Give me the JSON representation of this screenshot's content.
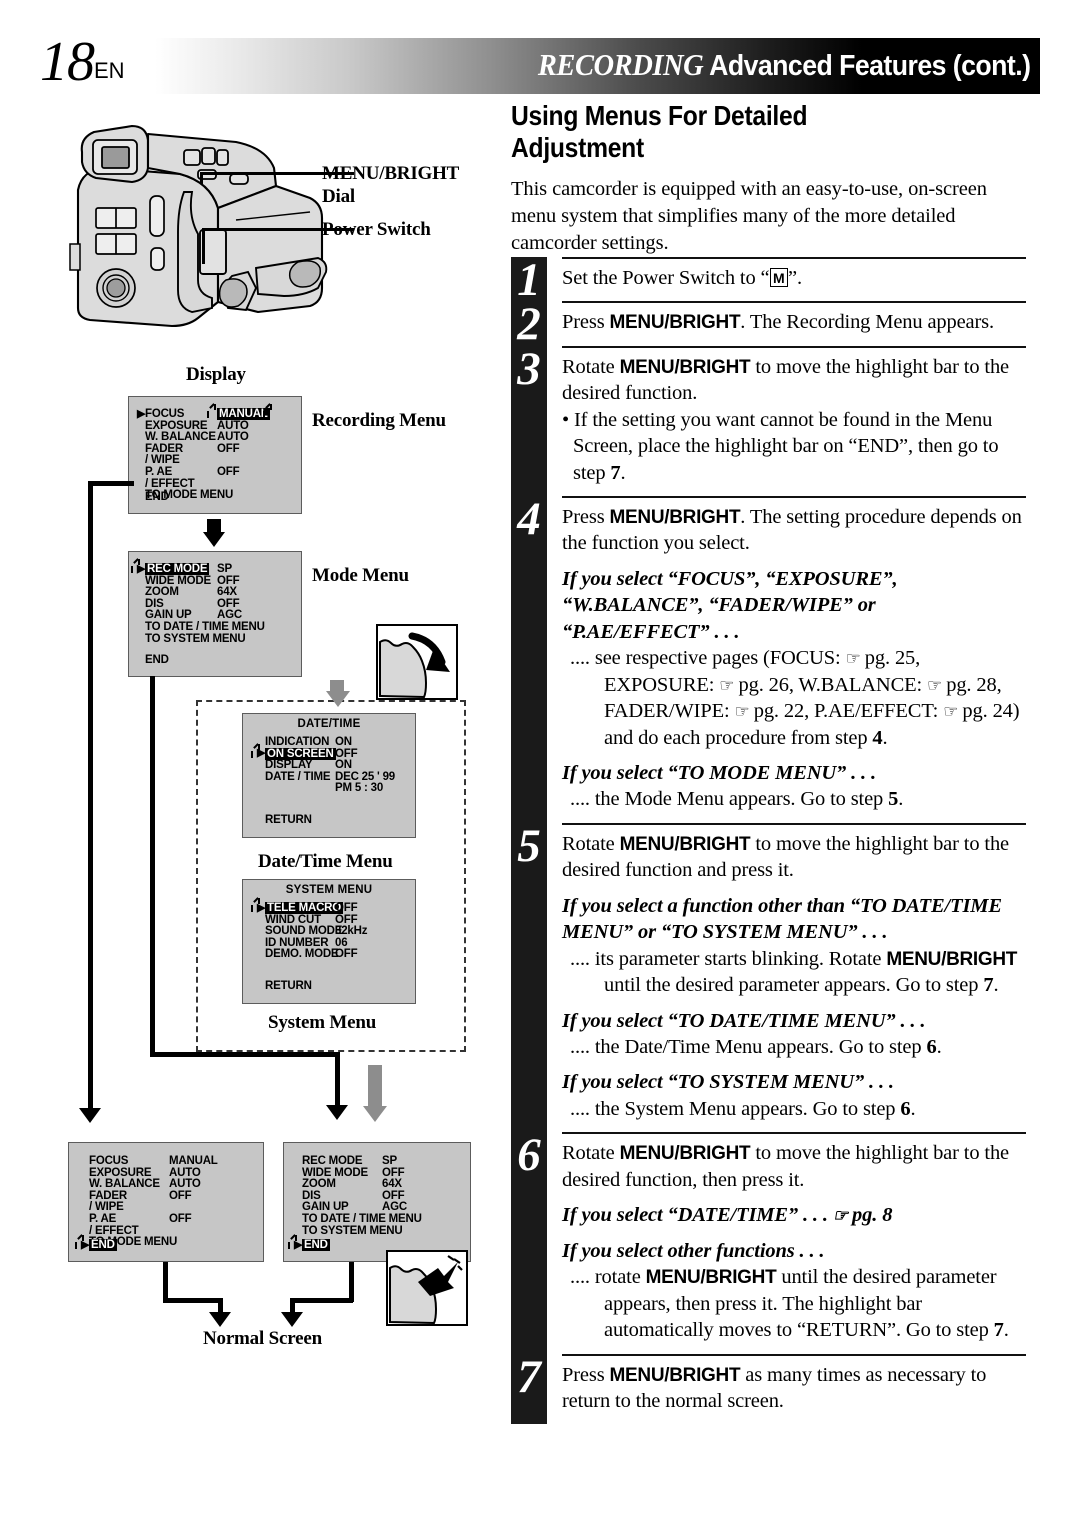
{
  "header": {
    "page_number": "18",
    "lang": "EN",
    "title_italic": "RECORDING",
    "title_rest": "Advanced Features (cont.)"
  },
  "section": {
    "title_line1": "Using Menus For Detailed",
    "title_line2": "Adjustment",
    "intro": "This camcorder is equipped with an easy-to-use, on-screen menu system that simplifies many of the more detailed camcorder settings."
  },
  "callouts": {
    "menu_bright_dial_l1": "MENU/BRIGHT",
    "menu_bright_dial_l2": "Dial",
    "power_switch": "Power Switch",
    "display": "Display"
  },
  "diagram_captions": {
    "recording_menu": "Recording Menu",
    "mode_menu": "Mode Menu",
    "date_time_menu": "Date/Time Menu",
    "system_menu": "System Menu",
    "normal_screen": "Normal Screen"
  },
  "icons": {
    "rotate_dial": "rotate-dial-icon",
    "press_dial": "press-dial-icon",
    "pointing_hand": "☞"
  },
  "screens": {
    "recording_menu": {
      "rows": [
        {
          "label": "FOCUS",
          "value": "MANUAL",
          "cursor": true,
          "value_highlight": true,
          "blink": true
        },
        {
          "label": "EXPOSURE",
          "value": "AUTO"
        },
        {
          "label": "W. BALANCE",
          "value": "AUTO"
        },
        {
          "label": "FADER",
          "value": "OFF"
        },
        {
          "label": "/ WIPE",
          "value": ""
        },
        {
          "label": "P. AE",
          "value": "OFF"
        },
        {
          "label": "/ EFFECT",
          "value": ""
        },
        {
          "label": "TO MODE MENU",
          "value": ""
        },
        {
          "label": "END",
          "value": ""
        }
      ]
    },
    "mode_menu": {
      "rows": [
        {
          "label": "REC MODE",
          "value": "SP",
          "cursor": true,
          "label_highlight": true,
          "blink": true
        },
        {
          "label": "WIDE MODE",
          "value": "OFF"
        },
        {
          "label": "ZOOM",
          "value": "64X"
        },
        {
          "label": "DIS",
          "value": "OFF"
        },
        {
          "label": "GAIN UP",
          "value": "AGC"
        },
        {
          "label": "TO DATE / TIME MENU",
          "value": ""
        },
        {
          "label": "TO SYSTEM MENU",
          "value": ""
        },
        {
          "label": "END",
          "value": ""
        }
      ]
    },
    "date_time_menu": {
      "title": "DATE/TIME",
      "rows": [
        {
          "label": "INDICATION",
          "value": "ON"
        },
        {
          "label": "ON SCREEN",
          "value": "OFF",
          "cursor": true,
          "label_highlight": true,
          "blink": true
        },
        {
          "label": "DISPLAY",
          "value": "ON"
        },
        {
          "label": "DATE / TIME",
          "value": "DEC 25 ' 99"
        },
        {
          "label": "",
          "value": "PM  5 : 30"
        },
        {
          "label": "RETURN",
          "value": ""
        }
      ]
    },
    "system_menu": {
      "title": "SYSTEM MENU",
      "rows": [
        {
          "label": "TELE MACRO",
          "value": "OFF",
          "cursor": true,
          "label_highlight": true,
          "blink": true
        },
        {
          "label": "WIND CUT",
          "value": "OFF"
        },
        {
          "label": "SOUND MODE",
          "value": "32kHz"
        },
        {
          "label": "ID NUMBER",
          "value": "06"
        },
        {
          "label": "DEMO. MODE",
          "value": "OFF"
        },
        {
          "label": "RETURN",
          "value": ""
        }
      ]
    },
    "recording_menu_end": {
      "rows": [
        {
          "label": "FOCUS",
          "value": "MANUAL"
        },
        {
          "label": "EXPOSURE",
          "value": "AUTO"
        },
        {
          "label": "W. BALANCE",
          "value": "AUTO"
        },
        {
          "label": "FADER",
          "value": "OFF"
        },
        {
          "label": "/ WIPE",
          "value": ""
        },
        {
          "label": "P. AE",
          "value": "OFF"
        },
        {
          "label": "/ EFFECT",
          "value": ""
        },
        {
          "label": "TO MODE MENU",
          "value": ""
        },
        {
          "label": "END",
          "value": "",
          "cursor": true,
          "label_highlight": true,
          "blink": true
        }
      ]
    },
    "mode_menu_end": {
      "rows": [
        {
          "label": "REC MODE",
          "value": "SP"
        },
        {
          "label": "WIDE MODE",
          "value": "OFF"
        },
        {
          "label": "ZOOM",
          "value": "64X"
        },
        {
          "label": "DIS",
          "value": "OFF"
        },
        {
          "label": "GAIN UP",
          "value": "AGC"
        },
        {
          "label": "TO DATE / TIME MENU",
          "value": ""
        },
        {
          "label": "TO SYSTEM MENU",
          "value": ""
        },
        {
          "label": "END",
          "value": "",
          "cursor": true,
          "label_highlight": true,
          "blink": true
        }
      ]
    }
  },
  "steps": [
    {
      "number": "1",
      "lines": [
        "Set the Power Switch to “ M ”."
      ]
    },
    {
      "number": "2",
      "lines": [
        "Press MENU/BRIGHT. The Recording Menu appears."
      ]
    },
    {
      "number": "3",
      "lines": [
        "Rotate MENU/BRIGHT to move the highlight bar to the desired function.",
        "• If the setting you want cannot be found in the Menu Screen, place the highlight bar on “END”, then go to step 7."
      ]
    },
    {
      "number": "4",
      "lines": [
        "Press MENU/BRIGHT. The setting procedure depends on the function you select.",
        "If you select “FOCUS”, “EXPOSURE”, “W.BALANCE”, “FADER/WIPE” or “P.AE/EFFECT” . . .",
        ".... see respective pages (FOCUS: ☞ pg. 25, EXPOSURE: ☞ pg. 26, W.BALANCE: ☞ pg. 28, FADER/WIPE: ☞ pg. 22, P.AE/EFFECT: ☞ pg. 24) and do each procedure from step 4.",
        "If you select “TO MODE MENU” . . .",
        ".... the Mode Menu appears. Go to step 5."
      ]
    },
    {
      "number": "5",
      "lines": [
        "Rotate MENU/BRIGHT to move the highlight bar to the desired function and press it.",
        "If you select a function other than “TO DATE/TIME MENU” or “TO SYSTEM MENU” . . .",
        ".... its parameter starts blinking. Rotate MENU/BRIGHT until the desired parameter appears. Go to step 7.",
        "If you select “TO DATE/TIME MENU” . . .",
        ".... the Date/Time Menu appears. Go to step 6.",
        "If you select “TO SYSTEM MENU” . . .",
        ".... the System Menu appears. Go to step 6."
      ]
    },
    {
      "number": "6",
      "lines": [
        "Rotate MENU/BRIGHT to move the highlight bar to the desired function, then press it.",
        "If you select “DATE/TIME” . . . ☞ pg. 8",
        "If you select other functions . . .",
        ".... rotate MENU/BRIGHT until the desired parameter appears, then press it. The highlight bar automatically moves to “RETURN”. Go to step 7."
      ]
    },
    {
      "number": "7",
      "lines": [
        "Press MENU/BRIGHT as many times as necessary to return to the normal screen."
      ]
    }
  ]
}
